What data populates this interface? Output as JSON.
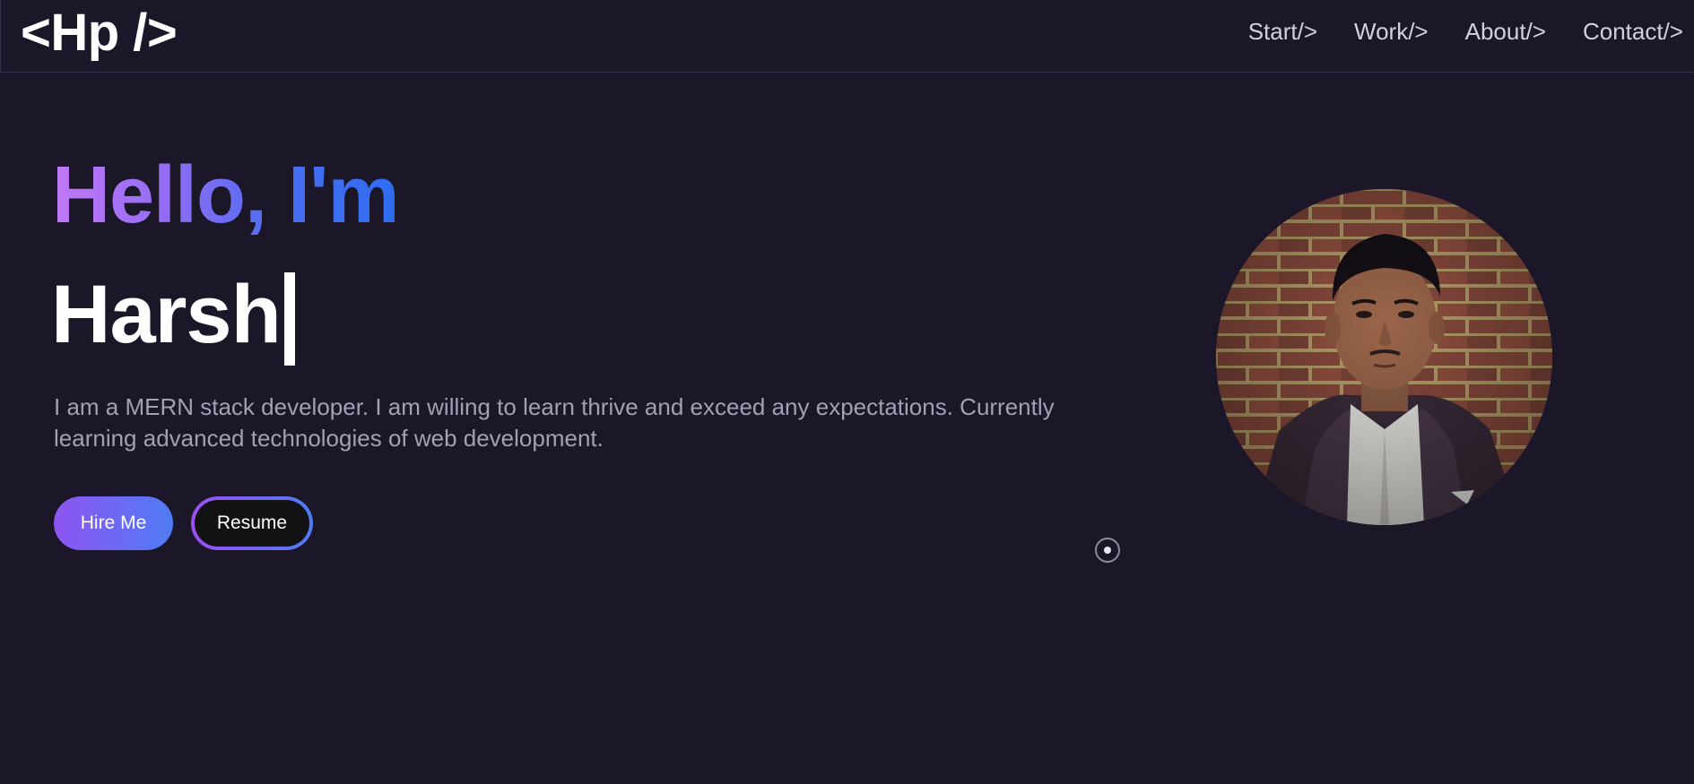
{
  "nav": {
    "logo": "<Hp />",
    "links": [
      "Start/>",
      "Work/>",
      "About/>",
      "Contact/>"
    ]
  },
  "hero": {
    "greeting": "Hello, I'm",
    "name": "Harsh",
    "description": "I am a MERN stack developer. I am willing to learn thrive and exceed any expectations. Currently learning advanced technologies of web development.",
    "buttons": {
      "hire": "Hire Me",
      "resume": "Resume"
    }
  },
  "colors": {
    "background": "#1b1628",
    "gradient_start": "#c279f6",
    "gradient_end": "#2d6df0",
    "text_muted": "#a3a0b4"
  },
  "icons": {
    "avatar": "profile-photo",
    "scroll": "scroll-indicator-icon"
  }
}
